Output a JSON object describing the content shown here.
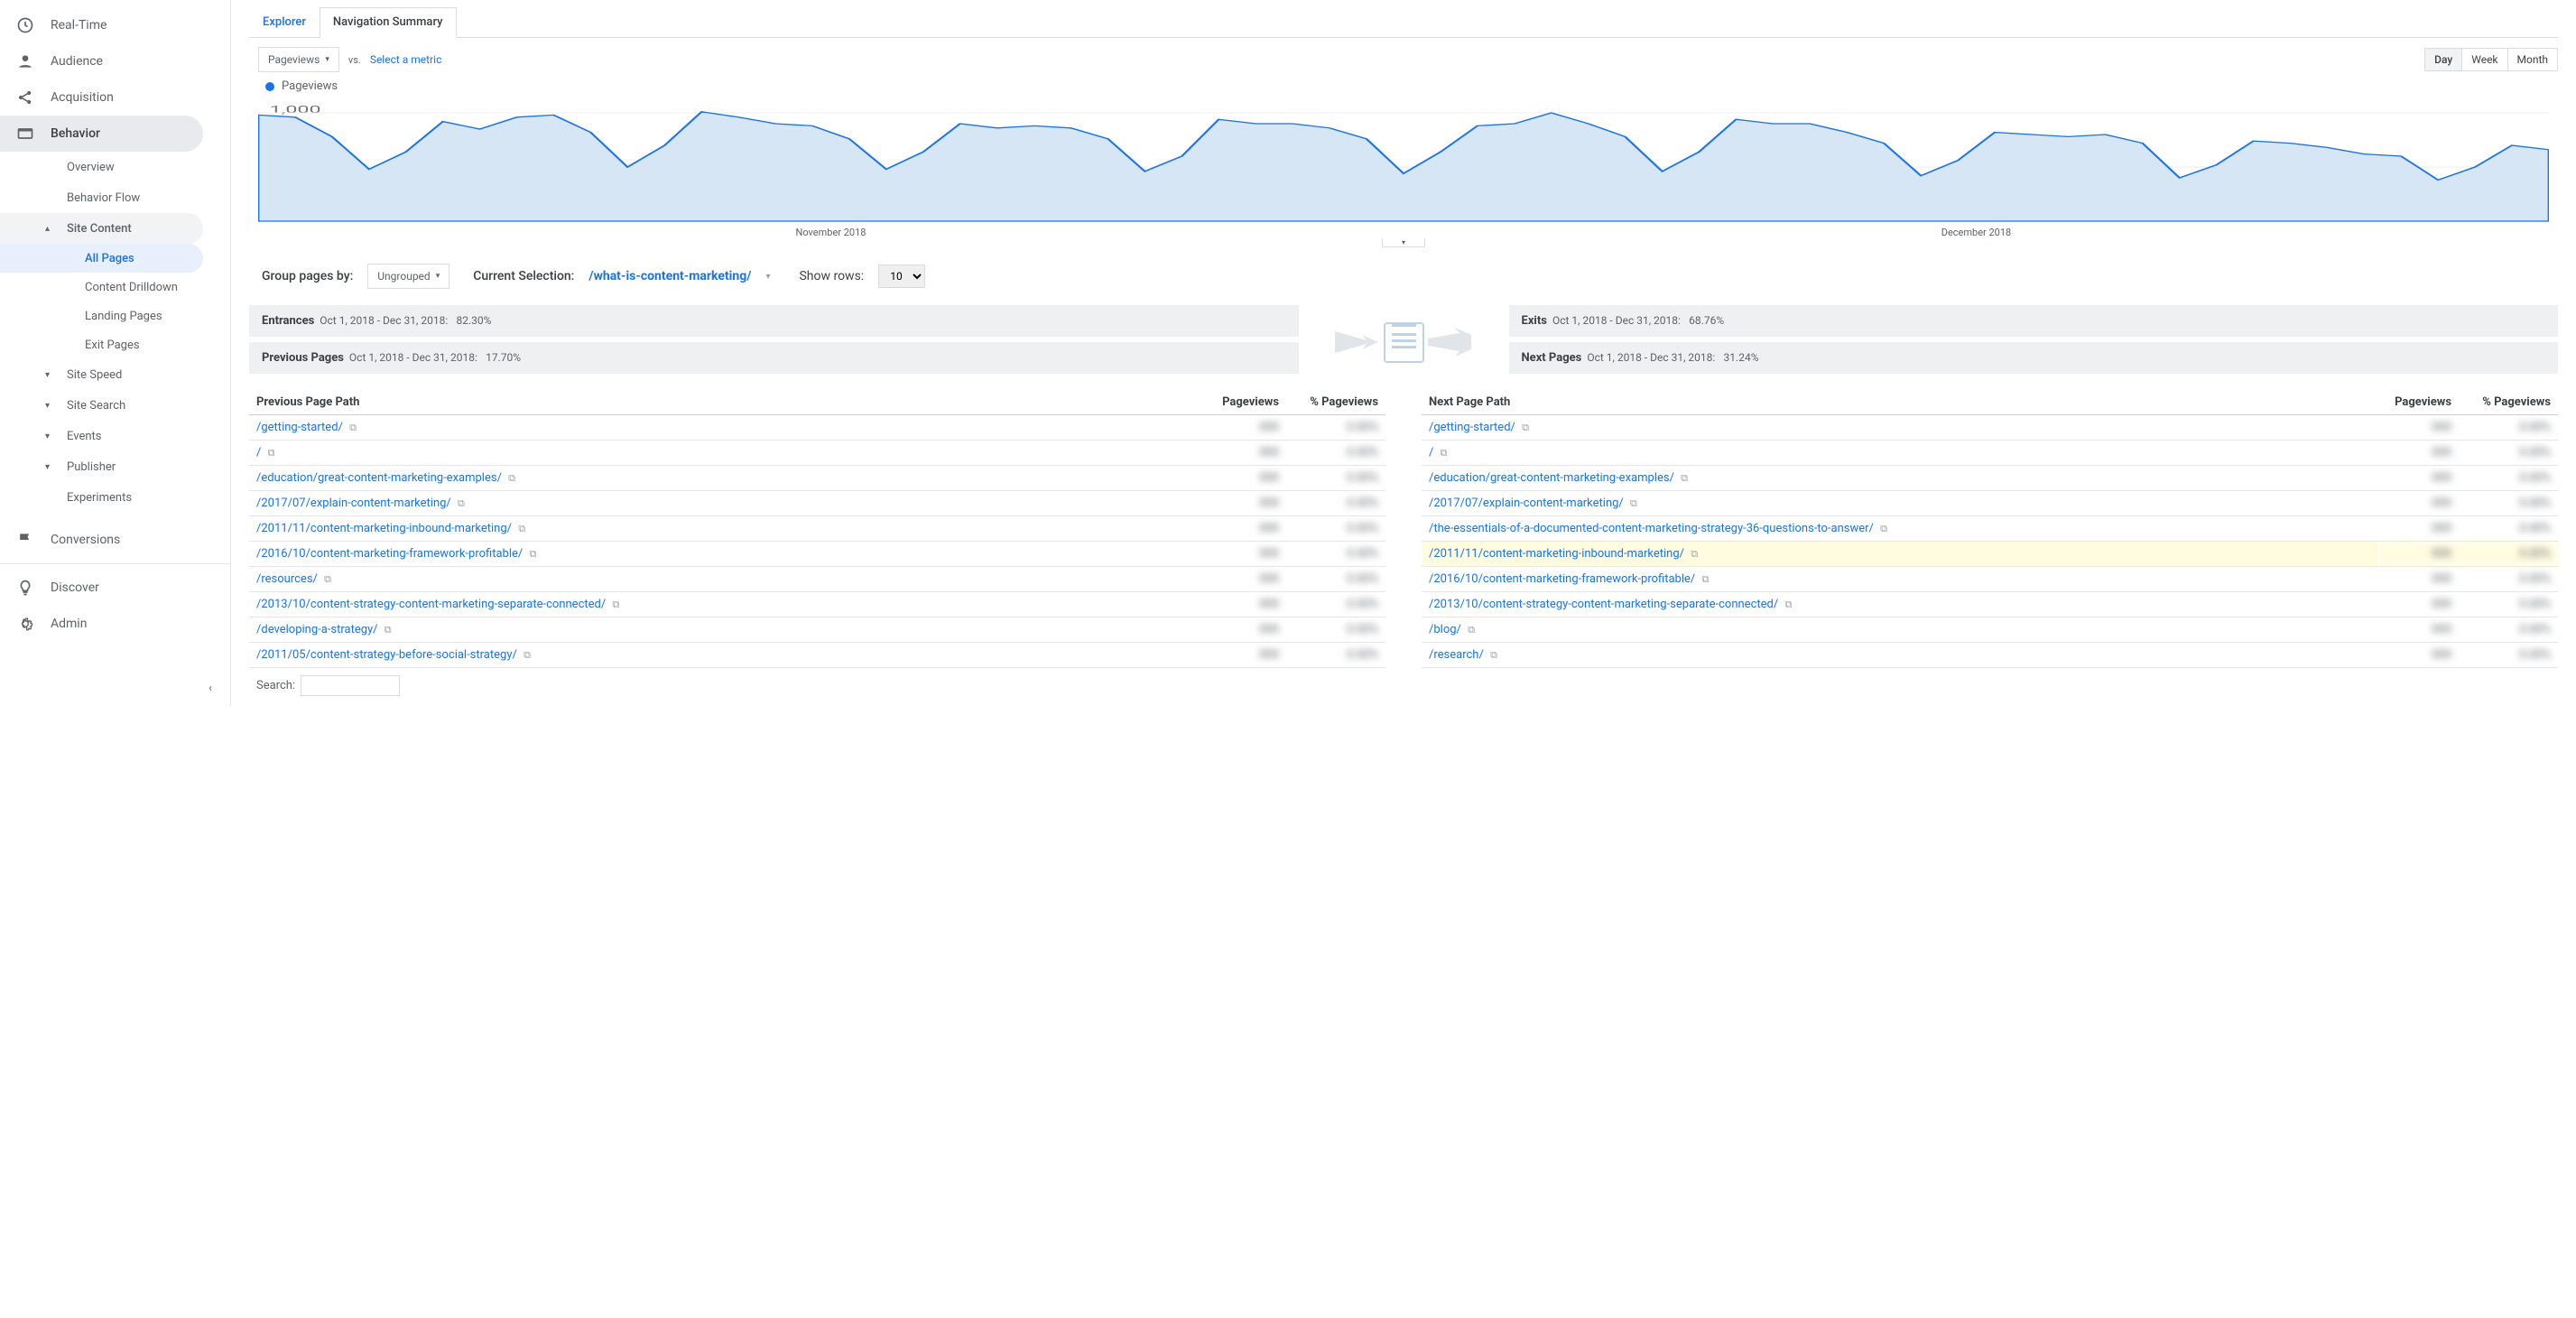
{
  "sidebar": {
    "items": [
      {
        "label": "Real-Time",
        "icon": "clock"
      },
      {
        "label": "Audience",
        "icon": "person"
      },
      {
        "label": "Acquisition",
        "icon": "share"
      },
      {
        "label": "Behavior",
        "icon": "behavior",
        "selected": true
      },
      {
        "label": "Conversions",
        "icon": "flag"
      },
      {
        "label": "Discover",
        "icon": "bulb"
      },
      {
        "label": "Admin",
        "icon": "gear"
      }
    ],
    "behavior_sub": [
      {
        "label": "Overview"
      },
      {
        "label": "Behavior Flow"
      },
      {
        "label": "Site Content",
        "expanded": true
      },
      {
        "label": "Site Speed",
        "expanded": false
      },
      {
        "label": "Site Search",
        "expanded": false
      },
      {
        "label": "Events",
        "expanded": false
      },
      {
        "label": "Publisher",
        "expanded": false
      },
      {
        "label": "Experiments"
      }
    ],
    "site_content_sub": [
      {
        "label": "All Pages",
        "active": true
      },
      {
        "label": "Content Drilldown"
      },
      {
        "label": "Landing Pages"
      },
      {
        "label": "Exit Pages"
      }
    ]
  },
  "tabs": {
    "explorer": "Explorer",
    "nav": "Navigation Summary"
  },
  "controls": {
    "metric": "Pageviews",
    "vs": "vs.",
    "select": "Select a metric",
    "day": "Day",
    "week": "Week",
    "month": "Month"
  },
  "legend": "Pageviews",
  "chart_data": {
    "type": "area",
    "xlabel": "",
    "ylabel": "",
    "ylim": [
      0,
      1000
    ],
    "yticks": [
      500,
      1000
    ],
    "x_months": [
      "November 2018",
      "December 2018"
    ],
    "values": [
      980,
      960,
      780,
      480,
      640,
      920,
      850,
      960,
      980,
      820,
      500,
      700,
      1010,
      960,
      900,
      880,
      760,
      480,
      640,
      900,
      860,
      880,
      860,
      760,
      460,
      600,
      940,
      900,
      900,
      860,
      760,
      440,
      640,
      880,
      900,
      1000,
      900,
      780,
      460,
      640,
      940,
      900,
      900,
      820,
      720,
      420,
      560,
      820,
      800,
      780,
      800,
      720,
      400,
      520,
      740,
      720,
      680,
      620,
      600,
      380,
      500,
      700,
      660
    ],
    "title": ""
  },
  "grouping": {
    "label": "Group pages by:",
    "value": "Ungrouped",
    "currentLabel": "Current Selection:",
    "currentPath": "/what-is-content-marketing/",
    "showRows": "Show rows:",
    "rows": "10"
  },
  "summary": {
    "entrances": {
      "title": "Entrances",
      "range": "Oct 1, 2018 - Dec 31, 2018:",
      "pct": "82.30%"
    },
    "prev": {
      "title": "Previous Pages",
      "range": "Oct 1, 2018 - Dec 31, 2018:",
      "pct": "17.70%"
    },
    "exits": {
      "title": "Exits",
      "range": "Oct 1, 2018 - Dec 31, 2018:",
      "pct": "68.76%"
    },
    "next": {
      "title": "Next Pages",
      "range": "Oct 1, 2018 - Dec 31, 2018:",
      "pct": "31.24%"
    }
  },
  "headers": {
    "prev": "Previous Page Path",
    "next": "Next Page Path",
    "pv": "Pageviews",
    "pctpv": "% Pageviews"
  },
  "prev_rows": [
    {
      "path": "/getting-started/"
    },
    {
      "path": "/"
    },
    {
      "path": "/education/great-content-marketing-examples/"
    },
    {
      "path": "/2017/07/explain-content-marketing/"
    },
    {
      "path": "/2011/11/content-marketing-inbound-marketing/"
    },
    {
      "path": "/2016/10/content-marketing-framework-profitable/"
    },
    {
      "path": "/resources/"
    },
    {
      "path": "/2013/10/content-strategy-content-marketing-separate-connected/"
    },
    {
      "path": "/developing-a-strategy/"
    },
    {
      "path": "/2011/05/content-strategy-before-social-strategy/"
    }
  ],
  "next_rows": [
    {
      "path": "/getting-started/"
    },
    {
      "path": "/"
    },
    {
      "path": "/education/great-content-marketing-examples/"
    },
    {
      "path": "/2017/07/explain-content-marketing/"
    },
    {
      "path": "/the-essentials-of-a-documented-content-marketing-strategy-36-questions-to-answer/"
    },
    {
      "path": "/2011/11/content-marketing-inbound-marketing/",
      "hl": true
    },
    {
      "path": "/2016/10/content-marketing-framework-profitable/"
    },
    {
      "path": "/2013/10/content-strategy-content-marketing-separate-connected/"
    },
    {
      "path": "/blog/"
    },
    {
      "path": "/research/"
    }
  ],
  "search_label": "Search:"
}
